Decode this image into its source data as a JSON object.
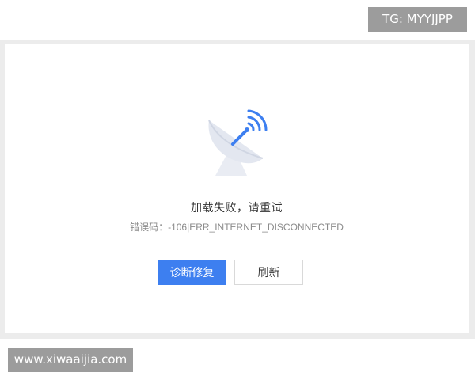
{
  "watermark": {
    "top": "TG: MYYJJPP",
    "bottom": "www.xiwaaijia.com"
  },
  "error": {
    "title": "加载失败，请重试",
    "code": "错误码：-106|ERR_INTERNET_DISCONNECTED"
  },
  "buttons": {
    "diagnose_label": "诊断修复",
    "refresh_label": "刷新"
  },
  "illustration": {
    "icon": "satellite-dish-icon",
    "colors": {
      "dish": "#e6e9f2",
      "accent": "#3d7ff0"
    }
  },
  "colors": {
    "primary": "#3d7ff0",
    "title_text": "#333333",
    "code_text": "#8a8a8a",
    "frame": "#ececec",
    "watermark_bg": "#9c9c9c"
  }
}
